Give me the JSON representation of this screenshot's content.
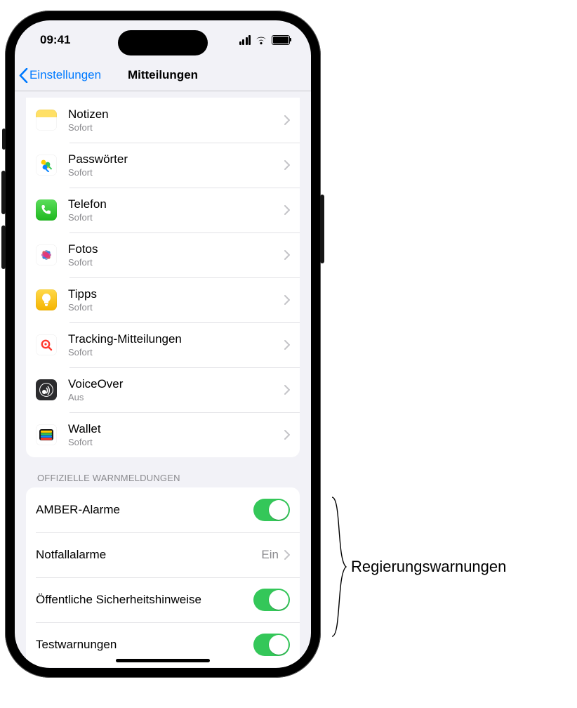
{
  "statusbar": {
    "time": "09:41"
  },
  "nav": {
    "back_label": "Einstellungen",
    "title": "Mitteilungen"
  },
  "apps": [
    {
      "name": "Notizen",
      "sub": "Sofort",
      "icon": "notes-icon"
    },
    {
      "name": "Passwörter",
      "sub": "Sofort",
      "icon": "passwords-icon"
    },
    {
      "name": "Telefon",
      "sub": "Sofort",
      "icon": "phone-icon"
    },
    {
      "name": "Fotos",
      "sub": "Sofort",
      "icon": "photos-icon"
    },
    {
      "name": "Tipps",
      "sub": "Sofort",
      "icon": "tips-icon"
    },
    {
      "name": "Tracking-Mitteilungen",
      "sub": "Sofort",
      "icon": "tracking-icon"
    },
    {
      "name": "VoiceOver",
      "sub": "Aus",
      "icon": "voiceover-icon"
    },
    {
      "name": "Wallet",
      "sub": "Sofort",
      "icon": "wallet-icon"
    }
  ],
  "alerts_header": "Offizielle Warnmeldungen",
  "alerts": {
    "amber": {
      "label": "AMBER-Alarme",
      "on": true
    },
    "emerg": {
      "label": "Notfallalarme",
      "value": "Ein"
    },
    "public": {
      "label": "Öffentliche Sicherheitshinweise",
      "on": true
    },
    "test": {
      "label": "Testwarnungen",
      "on": true
    }
  },
  "callout": {
    "label": "Regierungswarnungen"
  }
}
